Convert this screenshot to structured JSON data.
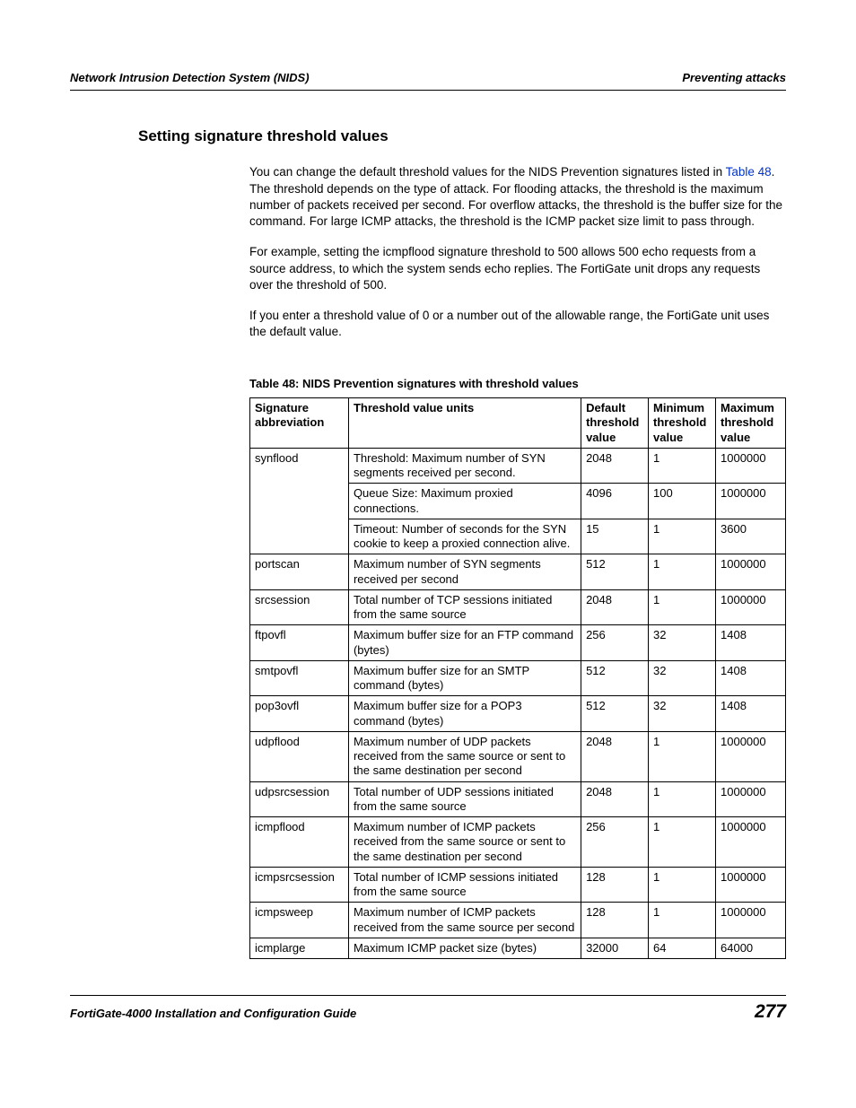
{
  "header": {
    "left": "Network Intrusion Detection System (NIDS)",
    "right": "Preventing attacks"
  },
  "section_title": "Setting signature threshold values",
  "paragraphs": {
    "p1a": "You can change the default threshold values for the NIDS Prevention signatures listed in ",
    "p1link": "Table 48",
    "p1b": ". The threshold depends on the type of attack. For flooding attacks, the threshold is the maximum number of packets received per second. For overflow attacks, the threshold is the buffer size for the command. For large ICMP attacks, the threshold is the ICMP packet size limit to pass through.",
    "p2": "For example, setting the icmpflood signature threshold to 500 allows 500 echo requests from a source address, to which the system sends echo replies. The FortiGate unit drops any requests over the threshold of 500.",
    "p3": "If you enter a threshold value of 0 or a number out of the allowable range, the FortiGate unit uses the default value."
  },
  "table_caption": "Table 48:  NIDS Prevention signatures with threshold values",
  "table": {
    "head": {
      "abbrev": "Signature abbreviation",
      "units": "Threshold value units",
      "def": "Default threshold value",
      "min": "Minimum threshold value",
      "max": "Maximum threshold value"
    },
    "rows": [
      {
        "abbrev": "synflood",
        "units": "Threshold: Maximum number of SYN segments received per second.",
        "def": "2048",
        "min": "1",
        "max": "1000000",
        "rowspan": 3
      },
      {
        "abbrev": "",
        "units": "Queue Size: Maximum proxied connections.",
        "def": "4096",
        "min": "100",
        "max": "1000000"
      },
      {
        "abbrev": "",
        "units": "Timeout: Number of seconds for the SYN cookie to keep a proxied connection alive.",
        "def": "15",
        "min": "1",
        "max": "3600"
      },
      {
        "abbrev": "portscan",
        "units": "Maximum number of SYN segments received per second",
        "def": "512",
        "min": "1",
        "max": "1000000"
      },
      {
        "abbrev": "srcsession",
        "units": "Total number of TCP sessions initiated from the same source",
        "def": "2048",
        "min": "1",
        "max": "1000000"
      },
      {
        "abbrev": "ftpovfl",
        "units": "Maximum buffer size for an FTP command (bytes)",
        "def": "256",
        "min": "32",
        "max": "1408"
      },
      {
        "abbrev": "smtpovfl",
        "units": "Maximum buffer size for an SMTP command (bytes)",
        "def": "512",
        "min": "32",
        "max": "1408"
      },
      {
        "abbrev": "pop3ovfl",
        "units": "Maximum buffer size for a POP3 command (bytes)",
        "def": "512",
        "min": "32",
        "max": "1408"
      },
      {
        "abbrev": "udpflood",
        "units": "Maximum number of UDP packets received from the same source or sent to the same destination per second",
        "def": "2048",
        "min": "1",
        "max": "1000000"
      },
      {
        "abbrev": "udpsrcsession",
        "units": "Total number of UDP sessions initiated from the same source",
        "def": "2048",
        "min": "1",
        "max": "1000000"
      },
      {
        "abbrev": "icmpflood",
        "units": "Maximum number of ICMP packets received from the same source or sent to the same destination per second",
        "def": "256",
        "min": "1",
        "max": "1000000"
      },
      {
        "abbrev": "icmpsrcsession",
        "units": "Total number of ICMP sessions initiated from the same source",
        "def": "128",
        "min": "1",
        "max": "1000000"
      },
      {
        "abbrev": "icmpsweep",
        "units": "Maximum number of ICMP packets received from the same source per second",
        "def": "128",
        "min": "1",
        "max": "1000000"
      },
      {
        "abbrev": "icmplarge",
        "units": "Maximum ICMP packet size (bytes)",
        "def": "32000",
        "min": "64",
        "max": "64000"
      }
    ]
  },
  "footer": {
    "left": "FortiGate-4000 Installation and Configuration Guide",
    "page": "277"
  }
}
